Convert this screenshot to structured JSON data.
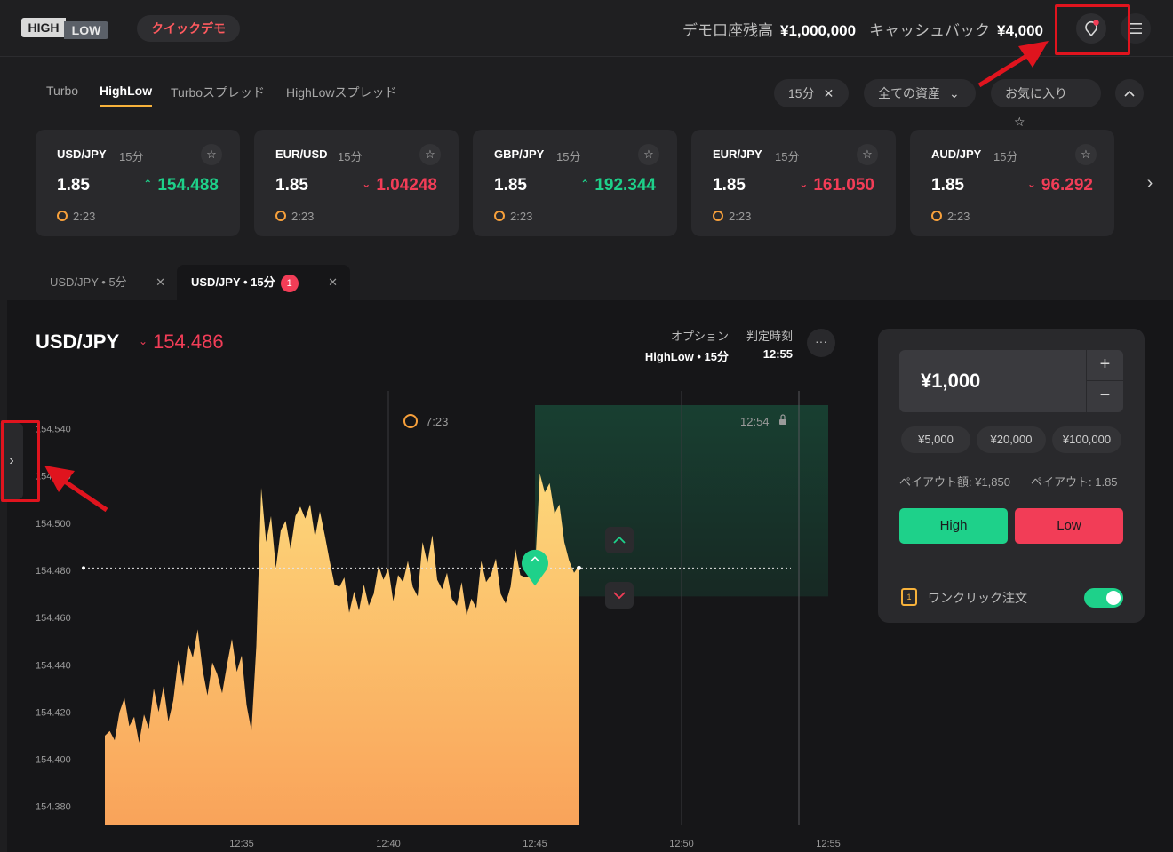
{
  "header": {
    "logo_top": "HIGH",
    "logo_bottom": "LOW",
    "mode_label": "クイックデモ",
    "balance_label": "デモ口座残高",
    "balance_value": "¥1,000,000",
    "cashback_label": "キャッシュバック",
    "cashback_value": "¥4,000"
  },
  "product_tabs": [
    {
      "label": "Turbo",
      "active": false
    },
    {
      "label": "HighLow",
      "active": true
    },
    {
      "label": "Turboスプレッド",
      "active": false
    },
    {
      "label": "HighLowスプレッド",
      "active": false
    }
  ],
  "filters": {
    "duration": "15分",
    "assets": "全ての資産",
    "favorites": "お気に入り"
  },
  "asset_cards": [
    {
      "pair": "USD/JPY",
      "duration": "15分",
      "payout": "1.85",
      "price": "154.488",
      "direction": "up",
      "timer": "2:23"
    },
    {
      "pair": "EUR/USD",
      "duration": "15分",
      "payout": "1.85",
      "price": "1.04248",
      "direction": "down",
      "timer": "2:23"
    },
    {
      "pair": "GBP/JPY",
      "duration": "15分",
      "payout": "1.85",
      "price": "192.344",
      "direction": "up",
      "timer": "2:23"
    },
    {
      "pair": "EUR/JPY",
      "duration": "15分",
      "payout": "1.85",
      "price": "161.050",
      "direction": "down",
      "timer": "2:23"
    },
    {
      "pair": "AUD/JPY",
      "duration": "15分",
      "payout": "1.85",
      "price": "96.292",
      "direction": "down",
      "timer": "2:23"
    }
  ],
  "chart_tabs": [
    {
      "label": "USD/JPY • 5分",
      "active": false
    },
    {
      "label": "USD/JPY • 15分",
      "active": true,
      "badge": "1"
    }
  ],
  "chart_header": {
    "pair": "USD/JPY",
    "price": "154.486",
    "option_label": "オプション",
    "option_value": "HighLow • 15分",
    "expiry_label": "判定時刻",
    "expiry_value": "12:55"
  },
  "chart_data": {
    "type": "area",
    "y_ticks": [
      "154.540",
      "154.520",
      "154.500",
      "154.480",
      "154.460",
      "154.440",
      "154.420",
      "154.400",
      "154.380"
    ],
    "x_ticks": [
      "12:35",
      "12:40",
      "12:45",
      "12:50",
      "12:55"
    ],
    "ylim": [
      154.372,
      154.55
    ],
    "xlim": [
      "12:30:20",
      "12:55:00"
    ],
    "entry_level": 154.481,
    "countdown_label": "7:23",
    "cutoff_label": "12:54",
    "series": [
      {
        "values": [
          [
            "12:30:20",
            154.41
          ],
          [
            "12:30:30",
            154.412
          ],
          [
            "12:30:40",
            154.408
          ],
          [
            "12:30:50",
            154.42
          ],
          [
            "12:31:00",
            154.426
          ],
          [
            "12:31:10",
            154.414
          ],
          [
            "12:31:20",
            154.418
          ],
          [
            "12:31:30",
            154.407
          ],
          [
            "12:31:40",
            154.419
          ],
          [
            "12:31:50",
            154.413
          ],
          [
            "12:32:00",
            154.43
          ],
          [
            "12:32:10",
            154.42
          ],
          [
            "12:32:20",
            154.431
          ],
          [
            "12:32:30",
            154.416
          ],
          [
            "12:32:40",
            154.425
          ],
          [
            "12:32:50",
            154.442
          ],
          [
            "12:33:00",
            154.431
          ],
          [
            "12:33:10",
            154.449
          ],
          [
            "12:33:20",
            154.443
          ],
          [
            "12:33:30",
            154.455
          ],
          [
            "12:33:40",
            154.438
          ],
          [
            "12:33:50",
            154.427
          ],
          [
            "12:34:00",
            154.441
          ],
          [
            "12:34:10",
            154.436
          ],
          [
            "12:34:20",
            154.428
          ],
          [
            "12:34:30",
            154.44
          ],
          [
            "12:34:40",
            154.451
          ],
          [
            "12:34:50",
            154.437
          ],
          [
            "12:35:00",
            154.444
          ],
          [
            "12:35:10",
            154.423
          ],
          [
            "12:35:20",
            154.412
          ],
          [
            "12:35:30",
            154.448
          ],
          [
            "12:35:40",
            154.515
          ],
          [
            "12:35:50",
            154.492
          ],
          [
            "12:36:00",
            154.503
          ],
          [
            "12:36:10",
            154.481
          ],
          [
            "12:36:20",
            154.497
          ],
          [
            "12:36:30",
            154.501
          ],
          [
            "12:36:40",
            154.489
          ],
          [
            "12:36:50",
            154.503
          ],
          [
            "12:37:00",
            154.507
          ],
          [
            "12:37:10",
            154.502
          ],
          [
            "12:37:20",
            154.508
          ],
          [
            "12:37:30",
            154.494
          ],
          [
            "12:37:40",
            154.505
          ],
          [
            "12:37:50",
            154.495
          ],
          [
            "12:38:00",
            154.484
          ],
          [
            "12:38:10",
            154.474
          ],
          [
            "12:38:20",
            154.473
          ],
          [
            "12:38:30",
            154.477
          ],
          [
            "12:38:40",
            154.462
          ],
          [
            "12:38:50",
            154.471
          ],
          [
            "12:39:00",
            154.463
          ],
          [
            "12:39:10",
            154.474
          ],
          [
            "12:39:20",
            154.465
          ],
          [
            "12:39:30",
            154.47
          ],
          [
            "12:39:40",
            154.482
          ],
          [
            "12:39:50",
            154.476
          ],
          [
            "12:40:00",
            154.481
          ],
          [
            "12:40:10",
            154.467
          ],
          [
            "12:40:20",
            154.478
          ],
          [
            "12:40:30",
            154.475
          ],
          [
            "12:40:40",
            154.484
          ],
          [
            "12:40:50",
            154.473
          ],
          [
            "12:41:00",
            154.469
          ],
          [
            "12:41:10",
            154.492
          ],
          [
            "12:41:20",
            154.483
          ],
          [
            "12:41:30",
            154.495
          ],
          [
            "12:41:40",
            154.476
          ],
          [
            "12:41:50",
            154.472
          ],
          [
            "12:42:00",
            154.479
          ],
          [
            "12:42:10",
            154.468
          ],
          [
            "12:42:20",
            154.465
          ],
          [
            "12:42:30",
            154.475
          ],
          [
            "12:42:40",
            154.461
          ],
          [
            "12:42:50",
            154.468
          ],
          [
            "12:43:00",
            154.464
          ],
          [
            "12:43:10",
            154.484
          ],
          [
            "12:43:20",
            154.475
          ],
          [
            "12:43:30",
            154.478
          ],
          [
            "12:43:40",
            154.485
          ],
          [
            "12:43:50",
            154.47
          ],
          [
            "12:44:00",
            154.466
          ],
          [
            "12:44:10",
            154.473
          ],
          [
            "12:44:20",
            154.489
          ],
          [
            "12:44:30",
            154.478
          ],
          [
            "12:44:40",
            154.477
          ],
          [
            "12:44:50",
            154.477
          ],
          [
            "12:45:00",
            154.48
          ],
          [
            "12:45:10",
            154.521
          ],
          [
            "12:45:20",
            154.513
          ],
          [
            "12:45:30",
            154.517
          ],
          [
            "12:45:40",
            154.504
          ],
          [
            "12:45:50",
            154.508
          ],
          [
            "12:46:00",
            154.492
          ],
          [
            "12:46:10",
            154.484
          ],
          [
            "12:46:20",
            154.479
          ],
          [
            "12:46:30",
            154.482
          ]
        ]
      }
    ]
  },
  "trade_panel": {
    "amount": "¥1,000",
    "plus": "+",
    "minus": "−",
    "presets": [
      "¥5,000",
      "¥20,000",
      "¥100,000"
    ],
    "payout_amount_label": "ペイアウト額: ¥1,850",
    "payout_label": "ペイアウト: 1.85",
    "high_label": "High",
    "low_label": "Low",
    "oneclick_label": "ワンクリック注文",
    "oneclick_on": true
  },
  "colors": {
    "up": "#1ed18a",
    "down": "#f23d57",
    "accent": "#f7b23b",
    "area_top": "#fdd77a",
    "area_bottom": "#f9a35a",
    "highlight": "#e0141e"
  }
}
